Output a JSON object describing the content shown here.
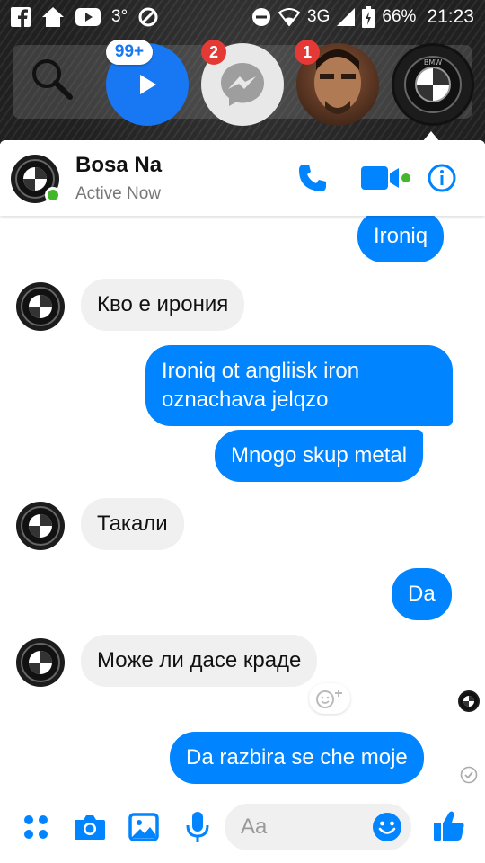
{
  "status_bar": {
    "left_icons": [
      "facebook-icon",
      "home-icon",
      "youtube-icon"
    ],
    "temperature": "3°",
    "network": "3G",
    "battery": "66%",
    "time": "21:23"
  },
  "chat_heads": {
    "badge_video": "99+",
    "badge_messenger": "2",
    "badge_person": "1"
  },
  "header": {
    "name": "Bosa Na",
    "status": "Active Now"
  },
  "messages": [
    {
      "from": "me",
      "lines": [
        "Ironiq"
      ]
    },
    {
      "from": "them",
      "lines": [
        "Кво е ирония"
      ]
    },
    {
      "from": "me",
      "lines": [
        "Ironiq ot angliisk iron",
        "oznachava jelqzo"
      ]
    },
    {
      "from": "me",
      "lines": [
        "Mnogo skup metal"
      ]
    },
    {
      "from": "them",
      "lines": [
        "Такали"
      ]
    },
    {
      "from": "me",
      "lines": [
        "Da"
      ]
    },
    {
      "from": "them",
      "lines": [
        "Може ли дасе краде"
      ]
    },
    {
      "from": "me",
      "lines": [
        "Da razbira se che moje"
      ]
    }
  ],
  "composer": {
    "placeholder": "Aa"
  },
  "colors": {
    "messenger_blue": "#0084ff",
    "icon_blue": "#1877f2",
    "online_green": "#42b72a",
    "badge_red": "#e53935"
  }
}
